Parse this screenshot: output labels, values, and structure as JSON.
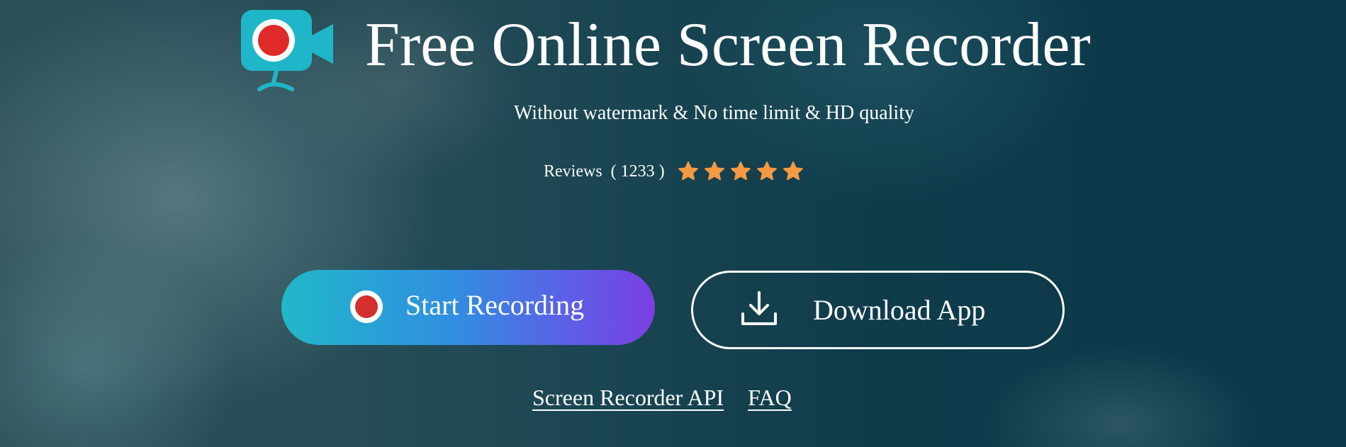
{
  "hero": {
    "logo_icon": "camera-record-logo-icon",
    "title": "Free Online Screen Recorder",
    "subtitle": "Without watermark & No time limit & HD quality",
    "reviews": {
      "label": "Reviews",
      "open": "(",
      "count": "1233",
      "close": ")",
      "rating": 5,
      "rating_max": 5,
      "star_icon": "star-icon",
      "star_color": "#f59a42"
    },
    "buttons": {
      "start_recording": {
        "label": "Start Recording",
        "icon": "record-icon",
        "gradient_start": "#22b8c9",
        "gradient_end": "#7a3fe2"
      },
      "download_app": {
        "label": "Download App",
        "icon": "download-icon"
      }
    },
    "links": {
      "api": "Screen Recorder API",
      "faq": "FAQ"
    }
  },
  "colors": {
    "logo_cyan": "#1fb6c9",
    "record_red": "#e02a2a",
    "text": "#ffffff",
    "background_dark": "#0b384a"
  }
}
